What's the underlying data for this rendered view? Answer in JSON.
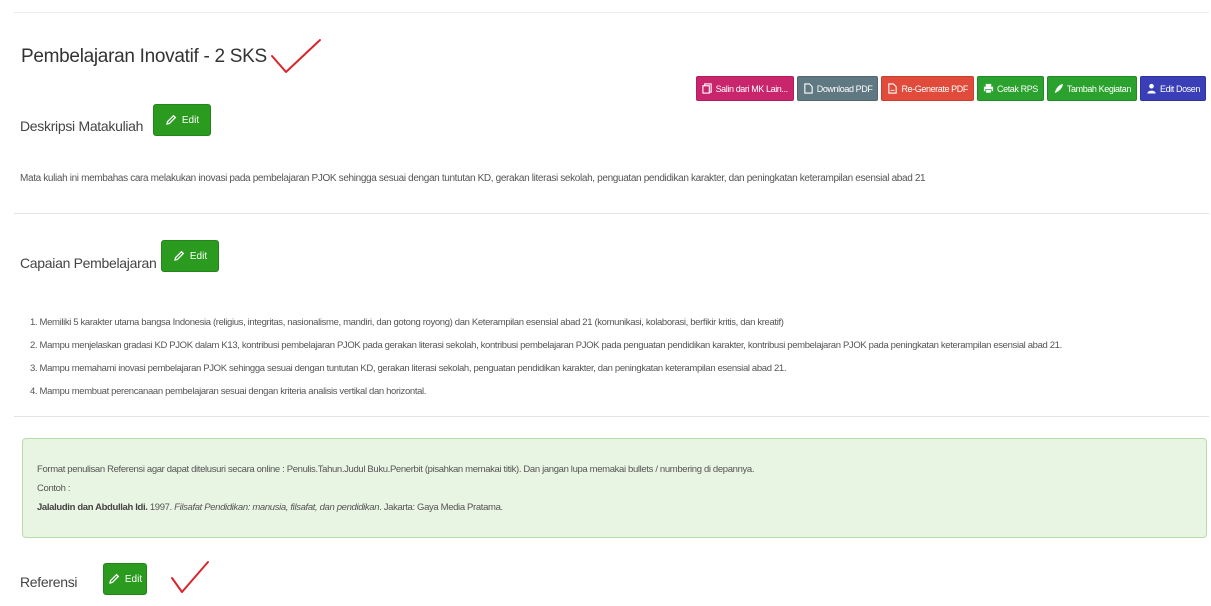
{
  "course": {
    "title": "Pembelajaran Inovatif - 2 SKS"
  },
  "toolbar": {
    "salin": "Salin dari MK Lain...",
    "download_pdf": "Download PDF",
    "regenerate_pdf": "Re-Generate PDF",
    "cetak_rps": "Cetak RPS",
    "tambah_kegiatan": "Tambah Kegiatan",
    "edit_dosen": "Edit Dosen"
  },
  "deskripsi": {
    "label": "Deskripsi Matakuliah",
    "edit_label": "Edit",
    "text": "Mata kuliah ini membahas cara melakukan inovasi pada pembelajaran PJOK sehingga sesuai dengan tuntutan KD, gerakan literasi sekolah, penguatan pendidikan karakter, dan peningkatan keterampilan esensial abad 21"
  },
  "capaian": {
    "label": "Capaian Pembelajaran",
    "edit_label": "Edit",
    "items": [
      "1. Memiliki 5 karakter utama bangsa Indonesia (religius, integritas, nasionalisme, mandiri, dan gotong royong) dan Keterampilan esensial abad 21 (komunikasi, kolaborasi, berfikir kritis, dan kreatif)",
      "2. Mampu menjelaskan gradasi KD PJOK dalam K13, kontribusi pembelajaran PJOK pada gerakan literasi sekolah, kontribusi pembelajaran PJOK pada penguatan pendidikan karakter, kontribusi pembelajaran PJOK pada peningkatan keterampilan esensial abad 21.",
      "3. Mampu memahami inovasi pembelajaran PJOK sehingga sesuai dengan tuntutan KD, gerakan literasi sekolah, penguatan pendidikan karakter, dan peningkatan keterampilan esensial abad 21.",
      "4. Mampu membuat perencanaan pembelajaran sesuai dengan kriteria analisis vertikal dan horizontal."
    ]
  },
  "referensi_info": {
    "format": "Format penulisan Referensi agar dapat ditelusuri secara online : Penulis.Tahun.Judul Buku.Penerbit (pisahkan memakai titik). Dan jangan lupa memakai bullets / numbering di depannya.",
    "contoh_label": "Contoh :",
    "example_author": "Jalaludin dan Abdullah Idi.",
    "example_year": " 1997. ",
    "example_title": "Filsafat Pendidikan: manusia, filsafat, dan pendidikan",
    "example_rest": ". Jakarta: Gaya Media Pratama."
  },
  "referensi": {
    "label": "Referensi",
    "edit_label": "Edit"
  },
  "colors": {
    "edit_green": "#2a9b1f",
    "salin_pink": "#c9256d",
    "download_grey": "#5f7882",
    "regenerate_red": "#e14b3b",
    "cetak_green": "#2aa22d",
    "dosen_blue": "#3a3fb8",
    "check_red": "#d9242b",
    "info_bg": "#e9f5e3"
  }
}
